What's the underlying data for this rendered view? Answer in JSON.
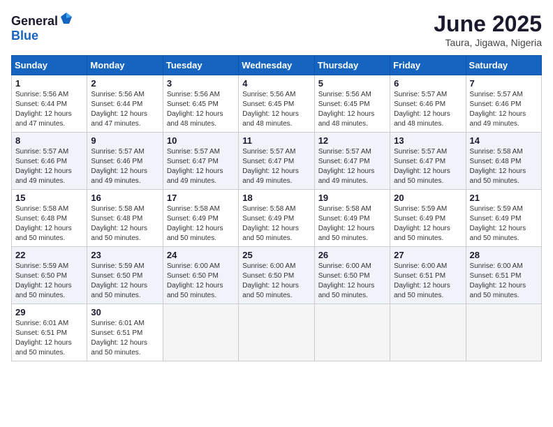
{
  "header": {
    "logo_general": "General",
    "logo_blue": "Blue",
    "month_title": "June 2025",
    "location": "Taura, Jigawa, Nigeria"
  },
  "calendar": {
    "days_header": [
      "Sunday",
      "Monday",
      "Tuesday",
      "Wednesday",
      "Thursday",
      "Friday",
      "Saturday"
    ],
    "weeks": [
      [
        {
          "day": "1",
          "sunrise": "5:56 AM",
          "sunset": "6:44 PM",
          "daylight": "12 hours and 47 minutes."
        },
        {
          "day": "2",
          "sunrise": "5:56 AM",
          "sunset": "6:44 PM",
          "daylight": "12 hours and 47 minutes."
        },
        {
          "day": "3",
          "sunrise": "5:56 AM",
          "sunset": "6:45 PM",
          "daylight": "12 hours and 48 minutes."
        },
        {
          "day": "4",
          "sunrise": "5:56 AM",
          "sunset": "6:45 PM",
          "daylight": "12 hours and 48 minutes."
        },
        {
          "day": "5",
          "sunrise": "5:56 AM",
          "sunset": "6:45 PM",
          "daylight": "12 hours and 48 minutes."
        },
        {
          "day": "6",
          "sunrise": "5:57 AM",
          "sunset": "6:46 PM",
          "daylight": "12 hours and 48 minutes."
        },
        {
          "day": "7",
          "sunrise": "5:57 AM",
          "sunset": "6:46 PM",
          "daylight": "12 hours and 49 minutes."
        }
      ],
      [
        {
          "day": "8",
          "sunrise": "5:57 AM",
          "sunset": "6:46 PM",
          "daylight": "12 hours and 49 minutes."
        },
        {
          "day": "9",
          "sunrise": "5:57 AM",
          "sunset": "6:46 PM",
          "daylight": "12 hours and 49 minutes."
        },
        {
          "day": "10",
          "sunrise": "5:57 AM",
          "sunset": "6:47 PM",
          "daylight": "12 hours and 49 minutes."
        },
        {
          "day": "11",
          "sunrise": "5:57 AM",
          "sunset": "6:47 PM",
          "daylight": "12 hours and 49 minutes."
        },
        {
          "day": "12",
          "sunrise": "5:57 AM",
          "sunset": "6:47 PM",
          "daylight": "12 hours and 49 minutes."
        },
        {
          "day": "13",
          "sunrise": "5:57 AM",
          "sunset": "6:47 PM",
          "daylight": "12 hours and 50 minutes."
        },
        {
          "day": "14",
          "sunrise": "5:58 AM",
          "sunset": "6:48 PM",
          "daylight": "12 hours and 50 minutes."
        }
      ],
      [
        {
          "day": "15",
          "sunrise": "5:58 AM",
          "sunset": "6:48 PM",
          "daylight": "12 hours and 50 minutes."
        },
        {
          "day": "16",
          "sunrise": "5:58 AM",
          "sunset": "6:48 PM",
          "daylight": "12 hours and 50 minutes."
        },
        {
          "day": "17",
          "sunrise": "5:58 AM",
          "sunset": "6:49 PM",
          "daylight": "12 hours and 50 minutes."
        },
        {
          "day": "18",
          "sunrise": "5:58 AM",
          "sunset": "6:49 PM",
          "daylight": "12 hours and 50 minutes."
        },
        {
          "day": "19",
          "sunrise": "5:58 AM",
          "sunset": "6:49 PM",
          "daylight": "12 hours and 50 minutes."
        },
        {
          "day": "20",
          "sunrise": "5:59 AM",
          "sunset": "6:49 PM",
          "daylight": "12 hours and 50 minutes."
        },
        {
          "day": "21",
          "sunrise": "5:59 AM",
          "sunset": "6:49 PM",
          "daylight": "12 hours and 50 minutes."
        }
      ],
      [
        {
          "day": "22",
          "sunrise": "5:59 AM",
          "sunset": "6:50 PM",
          "daylight": "12 hours and 50 minutes."
        },
        {
          "day": "23",
          "sunrise": "5:59 AM",
          "sunset": "6:50 PM",
          "daylight": "12 hours and 50 minutes."
        },
        {
          "day": "24",
          "sunrise": "6:00 AM",
          "sunset": "6:50 PM",
          "daylight": "12 hours and 50 minutes."
        },
        {
          "day": "25",
          "sunrise": "6:00 AM",
          "sunset": "6:50 PM",
          "daylight": "12 hours and 50 minutes."
        },
        {
          "day": "26",
          "sunrise": "6:00 AM",
          "sunset": "6:50 PM",
          "daylight": "12 hours and 50 minutes."
        },
        {
          "day": "27",
          "sunrise": "6:00 AM",
          "sunset": "6:51 PM",
          "daylight": "12 hours and 50 minutes."
        },
        {
          "day": "28",
          "sunrise": "6:00 AM",
          "sunset": "6:51 PM",
          "daylight": "12 hours and 50 minutes."
        }
      ],
      [
        {
          "day": "29",
          "sunrise": "6:01 AM",
          "sunset": "6:51 PM",
          "daylight": "12 hours and 50 minutes."
        },
        {
          "day": "30",
          "sunrise": "6:01 AM",
          "sunset": "6:51 PM",
          "daylight": "12 hours and 50 minutes."
        },
        null,
        null,
        null,
        null,
        null
      ]
    ]
  }
}
